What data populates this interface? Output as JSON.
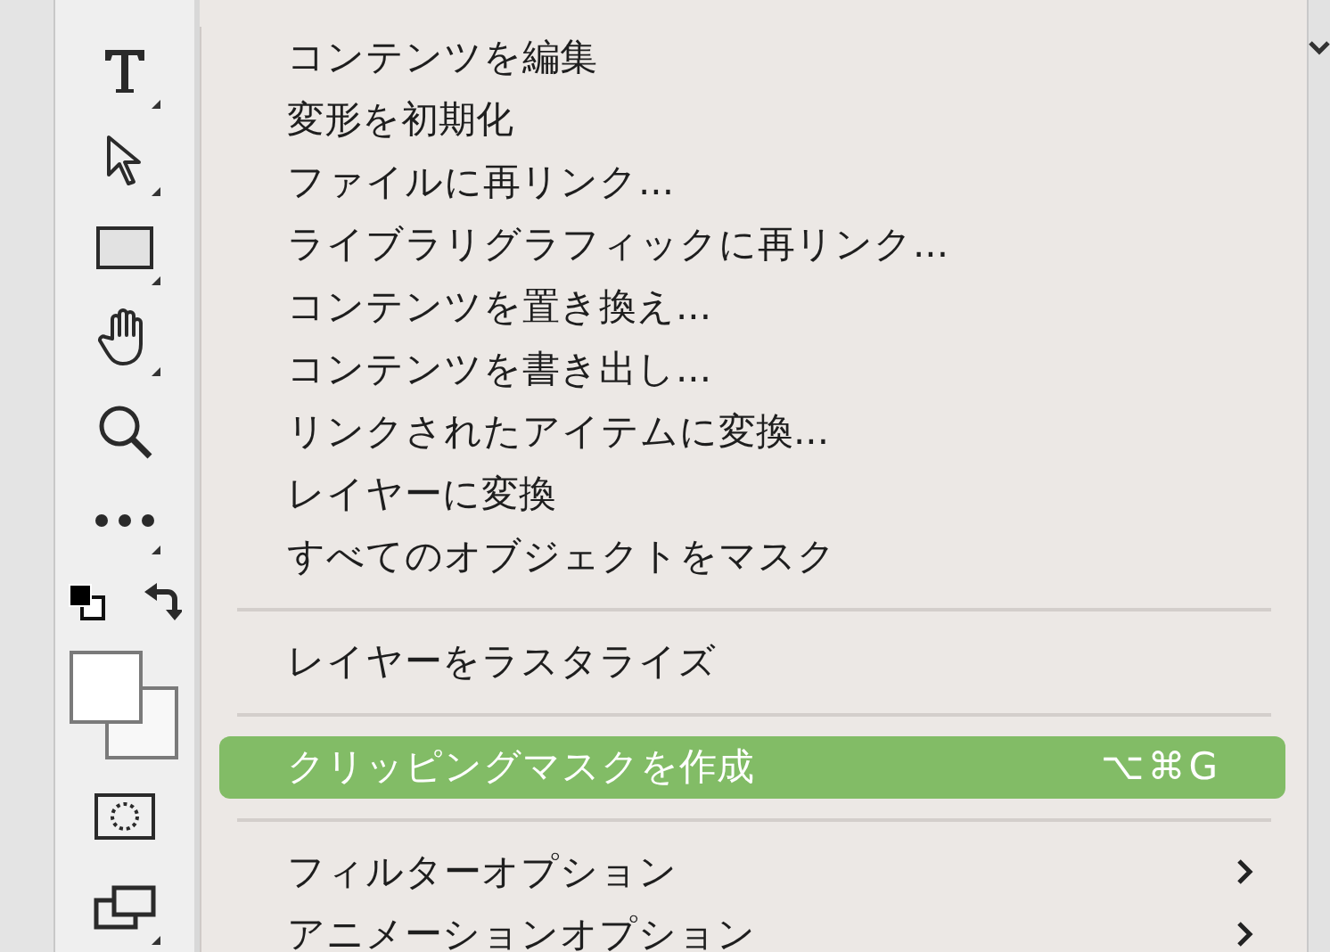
{
  "toolbar": {
    "tools": [
      {
        "kind": "type",
        "corner": true
      },
      {
        "kind": "pointer",
        "corner": true
      },
      {
        "kind": "rectangle",
        "corner": true
      },
      {
        "kind": "hand",
        "corner": true
      },
      {
        "kind": "zoom",
        "corner": false
      },
      {
        "kind": "more",
        "corner": true
      },
      {
        "kind": "swatches-small",
        "corner": false
      },
      {
        "kind": "swatches",
        "corner": false
      },
      {
        "kind": "quickmask",
        "corner": false
      },
      {
        "kind": "screenmode",
        "corner": true
      }
    ]
  },
  "menu": {
    "items": [
      {
        "kind": "item",
        "label": "コンテンツを編集",
        "submenu": false,
        "selected": false
      },
      {
        "kind": "item",
        "label": "変形を初期化",
        "submenu": false,
        "selected": false
      },
      {
        "kind": "item",
        "label": "ファイルに再リンク...",
        "submenu": false,
        "selected": false
      },
      {
        "kind": "item",
        "label": "ライブラリグラフィックに再リンク...",
        "submenu": false,
        "selected": false
      },
      {
        "kind": "item",
        "label": "コンテンツを置き換え...",
        "submenu": false,
        "selected": false
      },
      {
        "kind": "item",
        "label": "コンテンツを書き出し...",
        "submenu": false,
        "selected": false
      },
      {
        "kind": "item",
        "label": "リンクされたアイテムに変換...",
        "submenu": false,
        "selected": false
      },
      {
        "kind": "item",
        "label": "レイヤーに変換",
        "submenu": false,
        "selected": false
      },
      {
        "kind": "item",
        "label": "すべてのオブジェクトをマスク",
        "submenu": false,
        "selected": false
      },
      {
        "kind": "separator"
      },
      {
        "kind": "item",
        "label": "レイヤーをラスタライズ",
        "submenu": false,
        "selected": false
      },
      {
        "kind": "separator"
      },
      {
        "kind": "item",
        "label": "クリッピングマスクを作成",
        "shortcut": "⌥⌘G",
        "submenu": false,
        "selected": true
      },
      {
        "kind": "separator"
      },
      {
        "kind": "item",
        "label": "フィルターオプション",
        "submenu": true,
        "selected": false
      },
      {
        "kind": "item",
        "label": "アニメーションオプション",
        "submenu": true,
        "selected": false
      }
    ]
  }
}
